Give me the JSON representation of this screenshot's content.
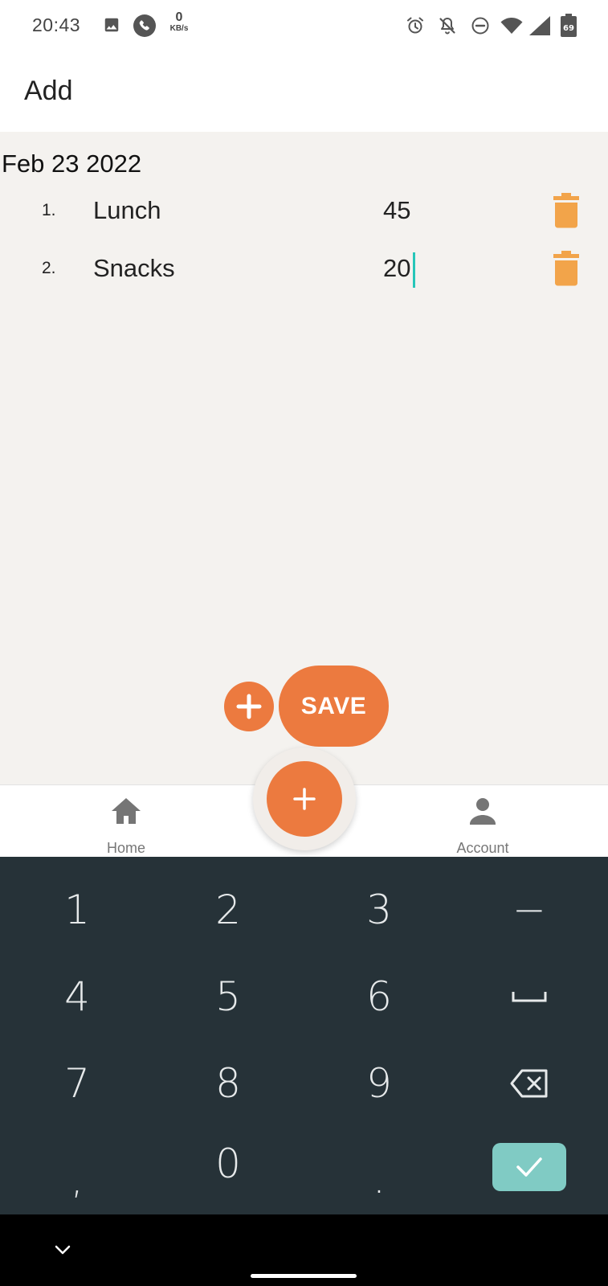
{
  "status_bar": {
    "time": "20:43",
    "data_rate_value": "0",
    "data_rate_unit": "KB/s",
    "battery_level": "69",
    "icons": [
      "image-icon",
      "phone-call-icon",
      "alarm-icon",
      "notifications-off-icon",
      "do-not-disturb-icon",
      "wifi-icon",
      "cell-signal-icon",
      "battery-icon"
    ]
  },
  "app_bar": {
    "title": "Add"
  },
  "content": {
    "date": "Feb 23 2022",
    "entries": [
      {
        "index": "1.",
        "name": "Lunch",
        "amount": "45"
      },
      {
        "index": "2.",
        "name": "Snacks",
        "amount": "20"
      }
    ]
  },
  "actions": {
    "save_label": "SAVE"
  },
  "bottom_nav": {
    "home_label": "Home",
    "account_label": "Account"
  },
  "keyboard": {
    "keys": [
      "1",
      "2",
      "3",
      "−",
      "4",
      "5",
      "6",
      "space",
      "7",
      "8",
      "9",
      "backspace",
      ",",
      "0",
      ".",
      "done"
    ]
  },
  "colors": {
    "accent": "#ec7a3f",
    "trash": "#f2a44a",
    "cursor": "#26c6b9",
    "keyboard_bg": "#263238",
    "done_key": "#80cbc4",
    "content_bg": "#f4f2ef"
  }
}
